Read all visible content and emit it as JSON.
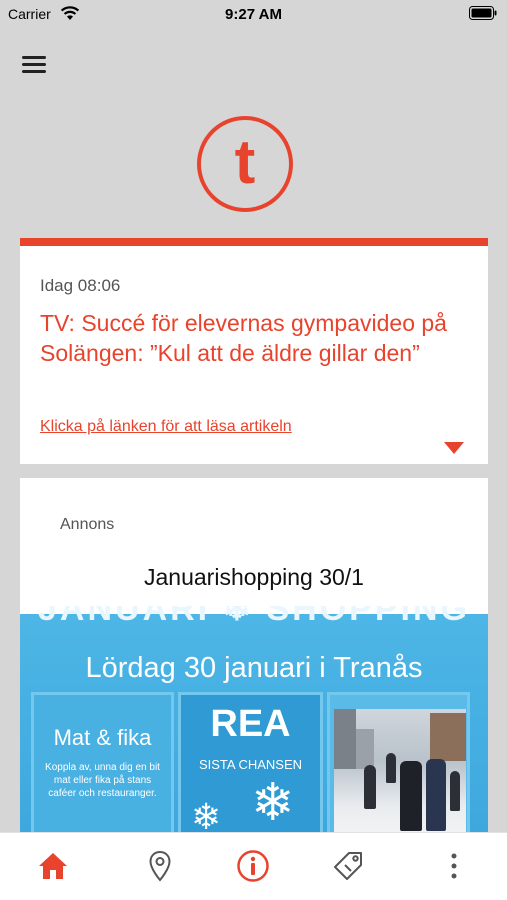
{
  "status_bar": {
    "carrier": "Carrier",
    "time": "9:27 AM"
  },
  "header": {
    "menu_icon": "hamburger-menu-icon",
    "logo_letter": "t",
    "brand_color": "#e8432d"
  },
  "news": {
    "timestamp": "Idag 08:06",
    "title": "TV: Succé för elevernas gympavideo på Solängen: ”Kul att de äldre gillar den”",
    "link_text": "Klicka på länken för att läsa artikeln",
    "expand_icon": "caret-down-icon"
  },
  "ad": {
    "label": "Annons",
    "title": "Januarishopping 30/1",
    "banner": {
      "heading": "JANUARI ❄ SHOPPING",
      "subheading": "Lördag 30 januari i Tranås",
      "food_title": "Mat & fika",
      "food_text": "Koppla av, unna dig en bit mat eller fika på stans caféer och restauranger.",
      "sale_title": "REA",
      "sale_subtitle": "SISTA CHANSEN",
      "banner_color": "#4db6e6"
    }
  },
  "tab_bar": {
    "tabs": [
      {
        "icon": "home-icon",
        "active": true
      },
      {
        "icon": "location-pin-icon",
        "active": false
      },
      {
        "icon": "info-icon",
        "active": false
      },
      {
        "icon": "tag-icon",
        "active": false
      },
      {
        "icon": "more-vertical-icon",
        "active": false
      }
    ]
  }
}
